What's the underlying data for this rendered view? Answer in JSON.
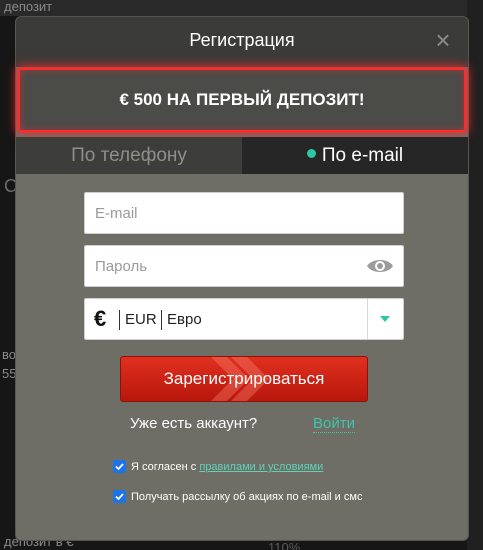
{
  "modal": {
    "title": "Регистрация",
    "close_glyph": "×",
    "promo": "€ 500 НА ПЕРВЫЙ ДЕПОЗИТ!"
  },
  "tabs": [
    {
      "label": "По телефону",
      "active": false
    },
    {
      "label": "По e-mail",
      "active": true
    }
  ],
  "form": {
    "email_placeholder": "E-mail",
    "email_value": "",
    "password_placeholder": "Пароль",
    "password_value": "",
    "currency": {
      "symbol": "€",
      "code": "EUR",
      "name": "Евро"
    },
    "register_label": "Зарегистрироваться",
    "login_question": "Уже есть аккаунт?",
    "login_link": "Войти"
  },
  "checkboxes": [
    {
      "checked": true,
      "text": "Я согласен с ",
      "link": "правилами и условиями"
    },
    {
      "checked": true,
      "text": "Получать рассылку об акциях по e-mail и смс"
    }
  ],
  "background": {
    "top_left": "депозит",
    "left_mid_1": "во",
    "left_mid_2": "55",
    "bottom_left": "депозит в €",
    "bottom_mid": "110%",
    "left_letter": "С"
  },
  "colors": {
    "accent_green": "#2ec7a4",
    "promo_border": "#ff2b2b",
    "register_red": "#d3271a",
    "checkbox_blue": "#1e73e8"
  },
  "icons": {
    "eye": "eye-icon",
    "close": "close-icon",
    "dropdown": "chevron-down-icon",
    "check": "checkmark-icon"
  }
}
